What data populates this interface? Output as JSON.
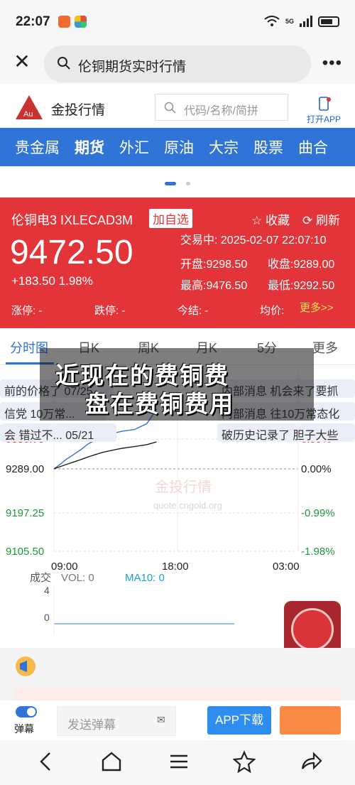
{
  "status": {
    "time": "22:07",
    "network": "5G"
  },
  "browser": {
    "query": "伦铜期货实时行情"
  },
  "site": {
    "name": "金投行情",
    "search_placeholder": "代码/名称/简拼",
    "open_app": "打开APP"
  },
  "categories": [
    "贵金属",
    "期货",
    "外汇",
    "原油",
    "大宗",
    "股票",
    "曲合"
  ],
  "quote": {
    "name": "伦铜电3 IXLECAD3M",
    "fav": "加自选",
    "collect": "☆ 收藏",
    "refresh": "⟳ 刷新",
    "price": "9472.50",
    "change": "+183.50 1.98%",
    "trade_time": "交易中: 2025-02-07 22:07:10",
    "open": "开盘:9298.50",
    "prev_close": "收盘:9289.00",
    "high": "最高:9476.50",
    "low": "最低:9292.50",
    "limit_up": "涨停: -",
    "limit_down": "跌停: -",
    "settle": "今结: -",
    "avg": "均价:",
    "more": "更多>>",
    "accent": "#e3343a"
  },
  "tabs": [
    "分时图",
    "日K",
    "周K",
    "月K",
    "5分",
    "更多"
  ],
  "chart_data": {
    "type": "line",
    "y_left_ticks": [
      "9380.75",
      "9289.00",
      "9197.25",
      "9105.50"
    ],
    "y_right_ticks": [
      "0.99%",
      "0.00%",
      "-0.99%",
      "-1.98%"
    ],
    "x_ticks": [
      "09:00",
      "18:00",
      "03:00"
    ],
    "ylim": [
      9105.5,
      9472.5
    ],
    "series": [
      {
        "x": [
          0.0,
          0.02,
          0.05,
          0.08,
          0.11,
          0.14,
          0.17,
          0.2,
          0.24,
          0.28,
          0.33,
          0.38,
          0.42
        ],
        "values": [
          9289,
          9300,
          9318,
          9333,
          9348,
          9366,
          9378,
          9388,
          9398,
          9405,
          9410,
          9428,
          9472.5
        ]
      }
    ],
    "volume_label": "成交",
    "vol": "VOL: 0",
    "ma10": "MA10: 0",
    "vol_ticks": [
      "4",
      "0"
    ]
  },
  "danmaku": [
    "前的价格了 07/25",
    "信党 10万常...",
    "会 错过不... 05/21",
    "内部消息 机会来了要抓",
    "内部消息 往10万常态化",
    "破历史记录了 胆子大些"
  ],
  "overlay": {
    "line1": "近现在的费铜费",
    "line2": "盘在费铜费用"
  },
  "watermark": "金投行情",
  "watermark_url": "quote.cngold.org",
  "bottom": {
    "danmu_label": "弹幕",
    "send_placeholder": "发送弹幕",
    "app_download": "APP下载"
  }
}
